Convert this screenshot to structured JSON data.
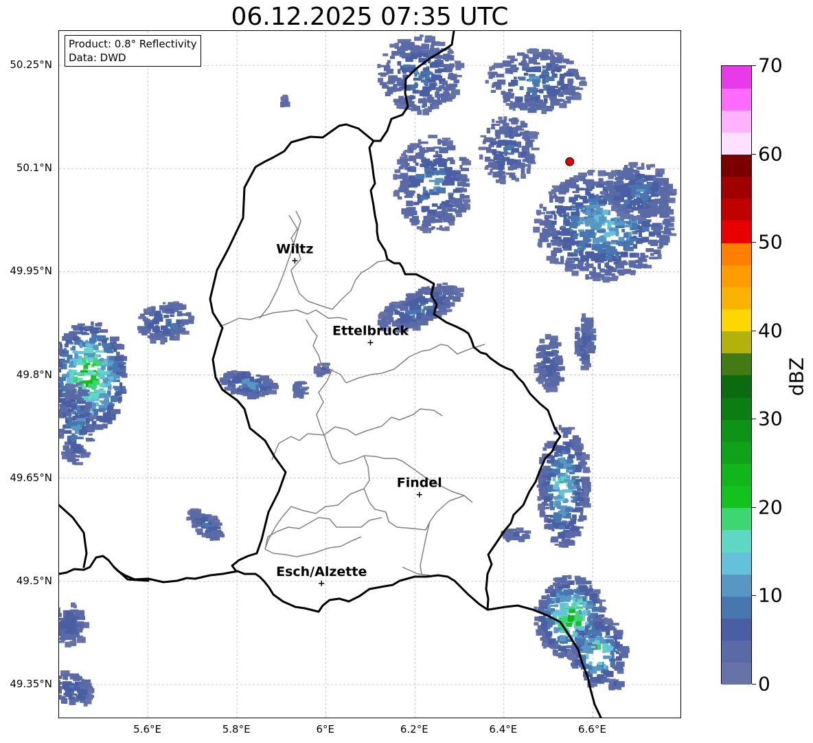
{
  "title": "06.12.2025 07:35 UTC",
  "info": {
    "product": "Product: 0.8° Reflectivity",
    "data": "Data: DWD"
  },
  "lat_ticks": [
    "50.25°N",
    "50.1°N",
    "49.95°N",
    "49.8°N",
    "49.65°N",
    "49.5°N",
    "49.35°N"
  ],
  "lon_ticks": [
    "5.6°E",
    "5.8°E",
    "6°E",
    "6.2°E",
    "6.4°E",
    "6.6°E"
  ],
  "colorbar": {
    "label": "dBZ",
    "ticks": [
      "0",
      "10",
      "20",
      "30",
      "40",
      "50",
      "60",
      "70"
    ],
    "range": [
      0,
      70
    ],
    "colors": [
      "#6573a8",
      "#5a6aa6",
      "#4a5fa3",
      "#4877b0",
      "#5896c4",
      "#65c0db",
      "#60d6c4",
      "#3dd673",
      "#14c21d",
      "#12b51a",
      "#10a319",
      "#0f9316",
      "#0b7d13",
      "#0a6b10",
      "#447a13",
      "#b3b20d",
      "#ffd700",
      "#fbb303",
      "#ff9d00",
      "#ff7f00",
      "#e80000",
      "#c10000",
      "#a00000",
      "#7a0000",
      "#ffe1ff",
      "#ffb3ff",
      "#ff6bff",
      "#e83ae8"
    ]
  },
  "cities": [
    {
      "name": "Wiltz",
      "lon": 5.93,
      "lat": 49.966
    },
    {
      "name": "Ettelbruck",
      "lon": 6.1,
      "lat": 49.847
    },
    {
      "name": "Findel",
      "lon": 6.21,
      "lat": 49.626
    },
    {
      "name": "Esch/Alzette",
      "lon": 5.99,
      "lat": 49.497
    }
  ],
  "radar_site": {
    "lon": 6.548,
    "lat": 50.11
  },
  "colors": {
    "border": "#000000",
    "cantons": "#808080",
    "radar_site": "#e00000",
    "grid": "#b0b0b0"
  }
}
